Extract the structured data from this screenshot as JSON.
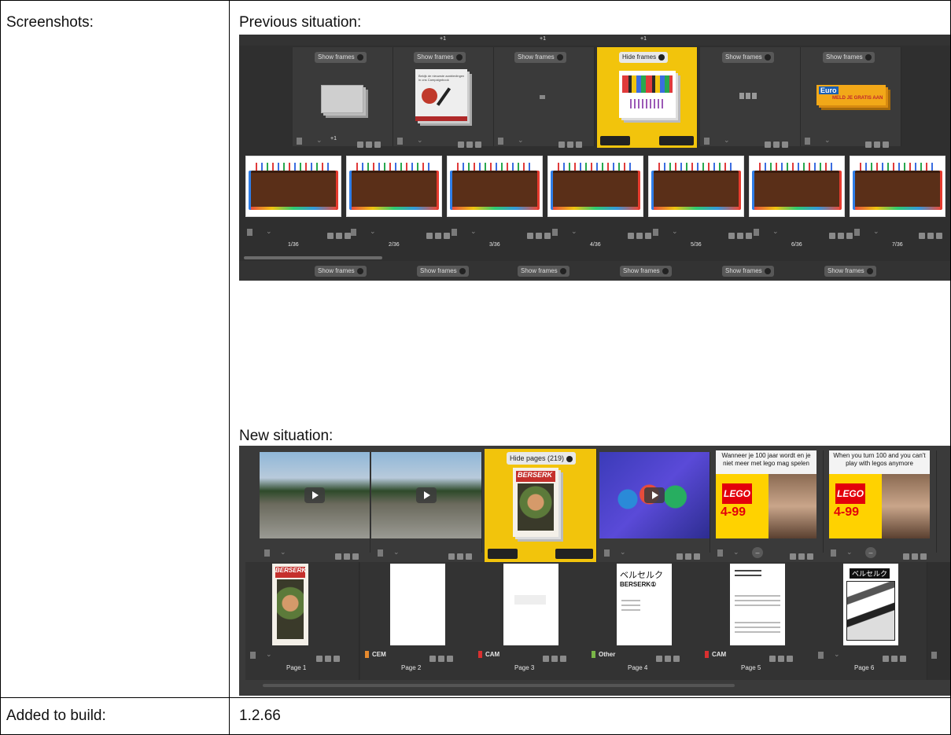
{
  "table": {
    "row1_label": "Screenshots:",
    "row2_label": "Added to build:",
    "build_version": "1.2.66"
  },
  "previous": {
    "heading": "Previous situation:",
    "top_counts": [
      "+1",
      "+1",
      "+1"
    ],
    "group_buttons": [
      "Show frames",
      "Show frames",
      "Show frames",
      "Hide frames",
      "Show frames",
      "Show frames"
    ],
    "group_extra_count": "+1",
    "group_caption_card2": [
      "Bekijk de nieuwste aanbiedingen",
      "in ons Campaignbook"
    ],
    "euro_banner": "Euro",
    "euro_sub": "MELD JE GRATIS AAN",
    "frame_counters": [
      "1/36",
      "2/36",
      "3/36",
      "4/36",
      "5/36",
      "6/36",
      "7/36"
    ],
    "bottom_buttons": [
      "Show frames",
      "Show frames",
      "Show frames",
      "Show frames",
      "Show frames",
      "Show frames"
    ]
  },
  "new": {
    "heading": "New situation:",
    "hide_pages_button": "Hide pages (219)",
    "cover_title": "BERSERK",
    "lego_captions": [
      "Wanneer je 100 jaar wordt en je niet meer met lego mag spelen",
      "When you turn 100 and you can't play with legos anymore"
    ],
    "lego_brand": "LEGO",
    "lego_age": "4-99",
    "page_tags": [
      "",
      "CEM",
      "CAM",
      "Other",
      "CAM",
      ""
    ],
    "page_labels": [
      "Page 1",
      "Page 2",
      "Page 3",
      "Page 4",
      "Page 5",
      "Page 6"
    ],
    "page4_title": "ベルセルク",
    "page4_sub": "BERSERK①",
    "circle_symbol": "–"
  },
  "colors": {
    "highlight": "#f2c40c",
    "panel": "#2f2f2f",
    "tag_cem": "#e68a2e",
    "tag_cam": "#d93030",
    "tag_other": "#7ab648"
  }
}
